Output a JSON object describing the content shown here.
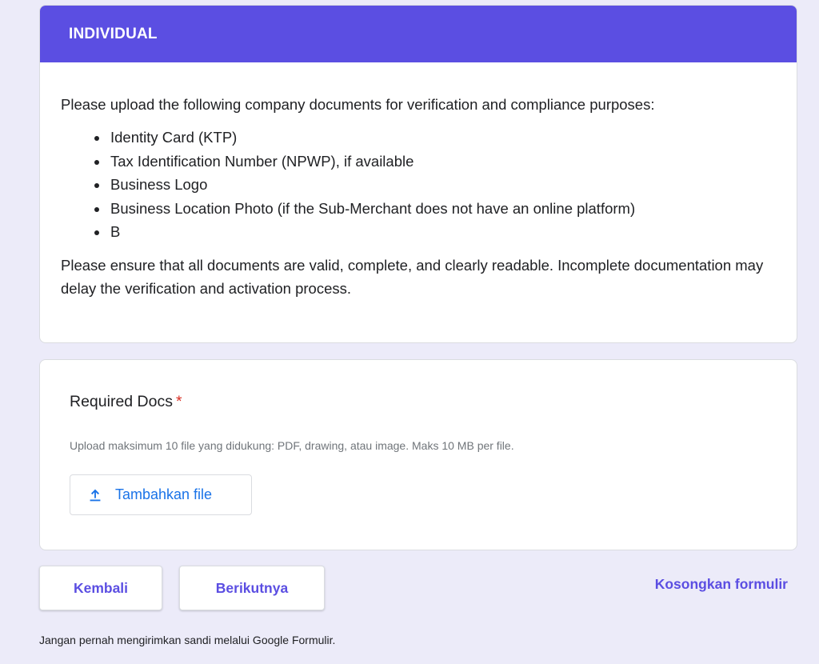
{
  "section": {
    "title": "INDIVIDUAL",
    "intro": "Please upload the following company documents for verification and compliance purposes:",
    "documents": [
      "Identity Card (KTP)",
      "Tax Identification Number (NPWP), if available",
      "Business Logo",
      "Business Location Photo (if the Sub-Merchant does not have an online platform)",
      "B"
    ],
    "note": "Please ensure that all documents are valid, complete, and clearly readable. Incomplete documentation may delay the verification and activation process."
  },
  "question": {
    "title": "Required Docs",
    "required_mark": "*",
    "hint": "Upload maksimum 10 file yang didukung: PDF, drawing, atau image. Maks 10 MB per file.",
    "upload_label": "Tambahkan file",
    "upload_icon": "upload-icon"
  },
  "navigation": {
    "back_label": "Kembali",
    "next_label": "Berikutnya",
    "clear_label": "Kosongkan formulir"
  },
  "footer": {
    "note": "Jangan pernah mengirimkan sandi melalui Google Formulir."
  },
  "colors": {
    "accent": "#5b4ee2",
    "page_background": "#ecebf9",
    "link_blue": "#1a73e8",
    "required_red": "#d93025"
  }
}
